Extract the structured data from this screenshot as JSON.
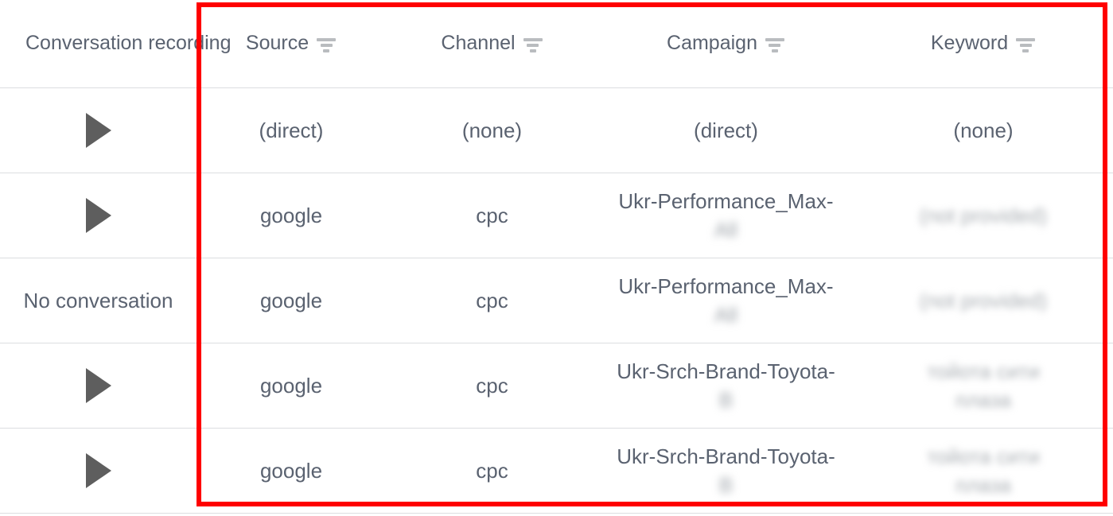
{
  "table": {
    "columns": [
      {
        "id": "recording",
        "label": "Conversation recording",
        "has_filter": false
      },
      {
        "id": "source",
        "label": "Source",
        "has_filter": true,
        "filter_icon": "filter-funnel-icon"
      },
      {
        "id": "channel",
        "label": "Channel",
        "has_filter": true,
        "filter_icon": "filter-funnel-icon"
      },
      {
        "id": "campaign",
        "label": "Campaign",
        "has_filter": true,
        "filter_icon": "filter-funnel-icon"
      },
      {
        "id": "keyword",
        "label": "Keyword",
        "has_filter": true,
        "filter_icon": "filter-funnel-icon"
      }
    ],
    "rows": [
      {
        "recording_type": "play",
        "recording_label": "",
        "recording_icon": "play-triangle-icon",
        "source": "(direct)",
        "channel": "(none)",
        "campaign_line1": "(direct)",
        "campaign_line2": "",
        "campaign_blurred": false,
        "keyword": "(none)",
        "keyword_blurred": false,
        "keyword_line2": ""
      },
      {
        "recording_type": "play",
        "recording_label": "",
        "recording_icon": "play-triangle-icon",
        "source": "google",
        "channel": "cpc",
        "campaign_line1": "Ukr-Performance_Max-",
        "campaign_line2": "All",
        "campaign_blurred": true,
        "keyword": "(not provided)",
        "keyword_blurred": true,
        "keyword_line2": ""
      },
      {
        "recording_type": "text",
        "recording_label": "No conversation",
        "recording_icon": "",
        "source": "google",
        "channel": "cpc",
        "campaign_line1": "Ukr-Performance_Max-",
        "campaign_line2": "All",
        "campaign_blurred": true,
        "keyword": "(not provided)",
        "keyword_blurred": true,
        "keyword_line2": ""
      },
      {
        "recording_type": "play",
        "recording_label": "",
        "recording_icon": "play-triangle-icon",
        "source": "google",
        "channel": "cpc",
        "campaign_line1": "Ukr-Srch-Brand-Toyota-",
        "campaign_line2": "B",
        "campaign_blurred": true,
        "keyword": "тойота сити",
        "keyword_blurred": true,
        "keyword_line2": "плаза"
      },
      {
        "recording_type": "play",
        "recording_label": "",
        "recording_icon": "play-triangle-icon",
        "source": "google",
        "channel": "cpc",
        "campaign_line1": "Ukr-Srch-Brand-Toyota-",
        "campaign_line2": "B",
        "campaign_blurred": true,
        "keyword": "тойота сити",
        "keyword_blurred": true,
        "keyword_line2": "плаза"
      }
    ]
  },
  "annotation": {
    "highlight_color": "#ff0000",
    "highlight_label": "red-selection-rectangle"
  },
  "colors": {
    "text": "#5a6270",
    "border": "#dcdee0",
    "icon": "#b9bcbf",
    "play": "#5e5e5e",
    "accent": "#ff0000",
    "background": "#ffffff"
  }
}
